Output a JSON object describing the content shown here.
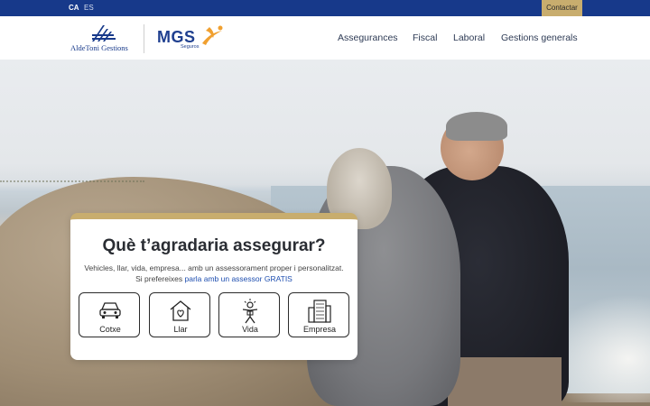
{
  "topbar": {
    "lang_ca": "CA",
    "lang_es": "ES",
    "contact_label": "Contactar"
  },
  "logos": {
    "alde_label": "AldeToni Gestions",
    "mgs_label": "MGS",
    "mgs_sub": "Seguros"
  },
  "nav": {
    "items": [
      "Assegurances",
      "Fiscal",
      "Laboral",
      "Gestions generals"
    ]
  },
  "card": {
    "title": "Què t’agradaria assegurar?",
    "description": "Vehicles, llar, vida, empresa... amb un assessorament proper i personalitzat.",
    "advisor_prefix": "Si prefereixes ",
    "advisor_link": "parla amb un assessor GRATIS",
    "options": [
      {
        "label": "Cotxe",
        "icon": "car-icon"
      },
      {
        "label": "Llar",
        "icon": "house-heart-icon"
      },
      {
        "label": "Vida",
        "icon": "person-life-icon"
      },
      {
        "label": "Empresa",
        "icon": "office-building-icon"
      }
    ]
  },
  "colors": {
    "topbar": "#17398a",
    "accent_gold": "#c8ad6e",
    "nav_text": "#2e3b55",
    "link": "#1f4fb0"
  }
}
